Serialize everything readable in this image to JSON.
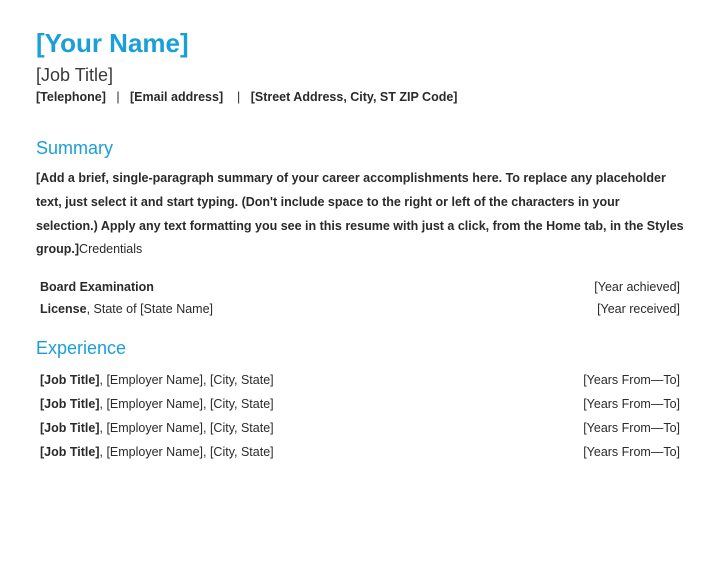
{
  "header": {
    "name": "[Your Name]",
    "job_title": "[Job Title]",
    "telephone": "[Telephone]",
    "email": "[Email address]",
    "address": "[Street Address, City, ST ZIP Code]"
  },
  "summary": {
    "heading": "Summary",
    "body": "[Add a brief, single-paragraph summary of your career accomplishments here. To replace any placeholder text, just select it and start typing. (Don't include space to the right or left of the characters in your selection.) Apply any text formatting you see in this resume with just a click, from the Home tab, in the Styles group.]",
    "trailing": "Credentials"
  },
  "credentials": [
    {
      "label_bold": "Board Examination",
      "label_rest": "",
      "right": "[Year achieved]"
    },
    {
      "label_bold": "License",
      "label_rest": ", State of [State Name]",
      "right": "[Year received]"
    }
  ],
  "experience": {
    "heading": "Experience",
    "items": [
      {
        "title": "[Job Title]",
        "rest": ", [Employer Name], [City, State]",
        "years": "[Years From—To]"
      },
      {
        "title": "[Job Title]",
        "rest": ", [Employer Name], [City, State]",
        "years": "[Years From—To]"
      },
      {
        "title": "[Job Title]",
        "rest": ", [Employer Name], [City, State]",
        "years": "[Years From—To]"
      },
      {
        "title": "[Job Title]",
        "rest": ", [Employer Name], [City, State]",
        "years": "[Years From—To]"
      }
    ]
  }
}
